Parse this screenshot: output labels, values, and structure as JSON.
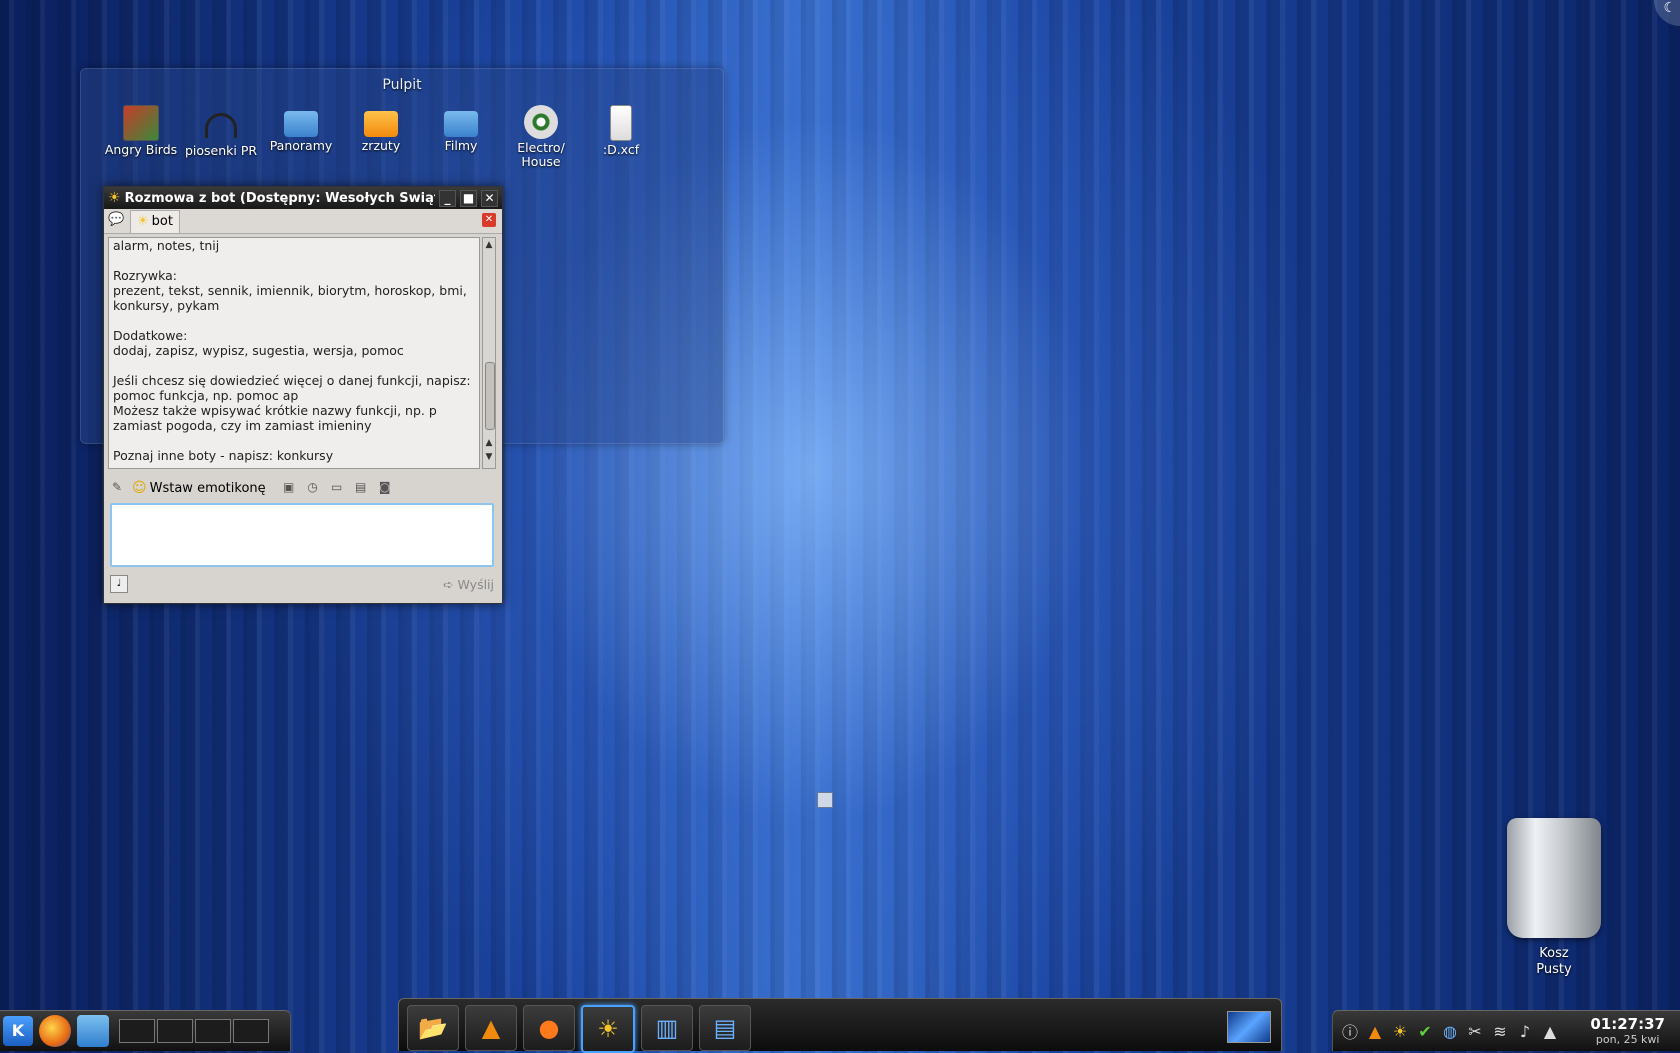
{
  "corner": {
    "glyph": "☾"
  },
  "folderview": {
    "title": "Pulpit",
    "icons": [
      {
        "label": "Angry Birds",
        "icon": "game-icon"
      },
      {
        "label": "piosenki PR",
        "icon": "headphones-icon"
      },
      {
        "label": "Panoramy",
        "icon": "folder-icon"
      },
      {
        "label": "zrzuty",
        "icon": "folder-icon"
      },
      {
        "label": "Filmy",
        "icon": "video-folder-icon"
      },
      {
        "label": "Electro/ House",
        "icon": "music-disc-icon"
      },
      {
        "label": ":D.xcf",
        "icon": "image-file-icon"
      }
    ]
  },
  "chat": {
    "title": "Rozmowa z bot (Dostępny: Wesołych Świąt)",
    "tab_label": "bot",
    "lines": [
      "alarm, notes, tnij",
      "Rozrywka:",
      "prezent, tekst, sennik, imiennik, biorytm, horoskop, bmi, konkursy, pykam",
      "Dodatkowe:",
      "dodaj, zapisz, wypisz, sugestia, wersja, pomoc",
      "Jeśli chcesz się dowiedzieć więcej o danej funkcji, napisz: pomoc funkcja, np. pomoc ap",
      "Możesz także wpisywać krótkie nazwy funkcji, np. p zamiast pogoda, czy im zamiast imieniny",
      "Poznaj inne boty - napisz: konkursy"
    ],
    "emoticon_label": "Wstaw emotikonę",
    "input_value": "",
    "send_label": "Wyślij"
  },
  "trash": {
    "name": "Kosz",
    "status": "Pusty"
  },
  "taskbar": {
    "start": "K",
    "tasks": [
      "file-manager-icon",
      "vlc-icon",
      "firefox-icon",
      "chat-sun-icon",
      "dolphin-icon",
      "documents-icon"
    ]
  },
  "clock": {
    "time": "01:27:37",
    "date": "pon, 25 kwi"
  }
}
